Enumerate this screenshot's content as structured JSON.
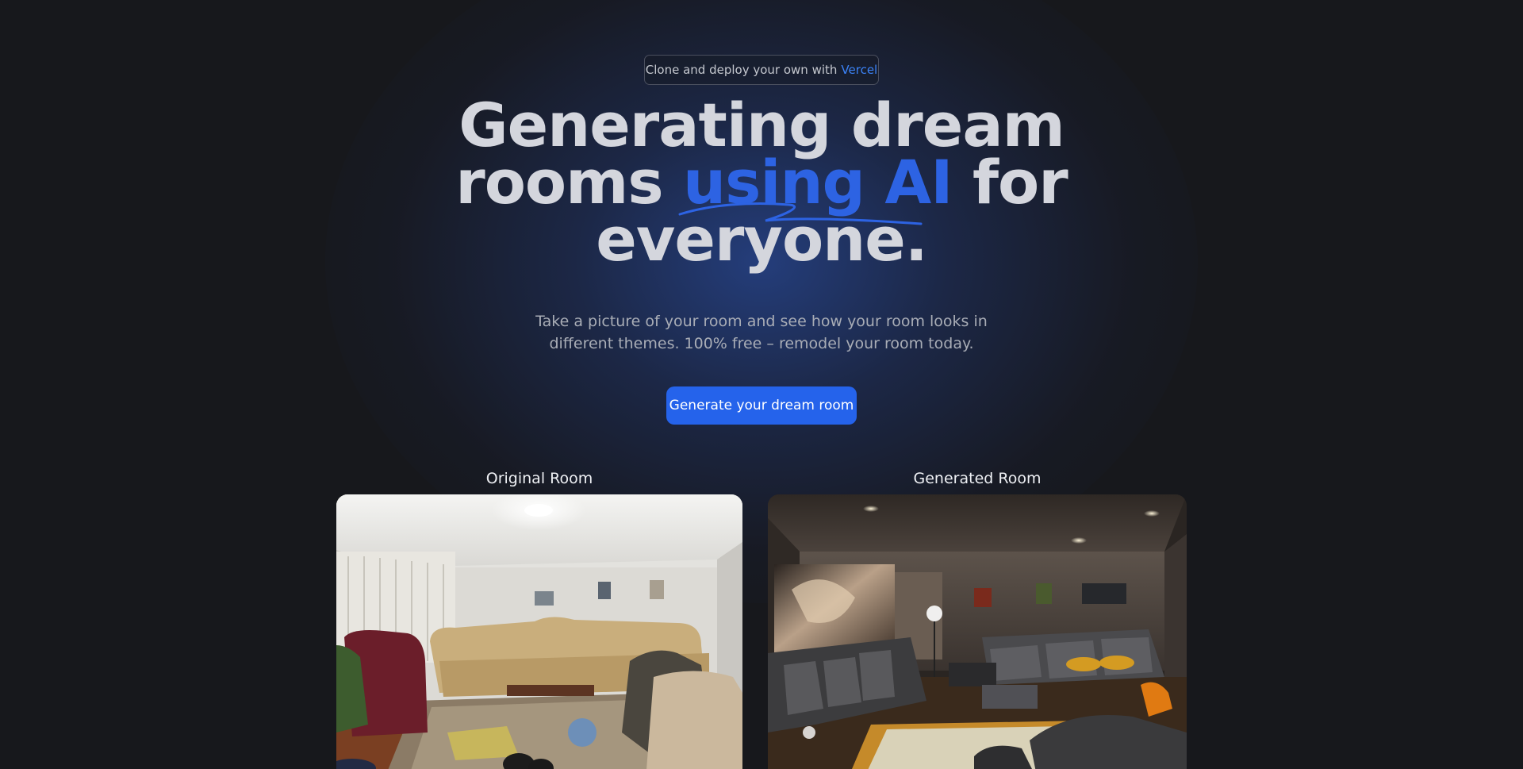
{
  "deploy_pill": {
    "prefix": "Clone and deploy your own with",
    "link": "Vercel"
  },
  "hero": {
    "line1": "Generating dream",
    "line2_before": "rooms",
    "line2_accent": "using AI",
    "line2_after": "for",
    "line3": "everyone."
  },
  "subtitle": {
    "line1": "Take a picture of your room and see how your room looks in",
    "line2": "different themes. 100% free – remodel your room today."
  },
  "cta": {
    "label": "Generate your dream room"
  },
  "comparison": {
    "original_label": "Original Room",
    "generated_label": "Generated Room"
  },
  "colors": {
    "background": "#17181c",
    "accent": "#2563eb",
    "headline": "#d4d6dd"
  }
}
